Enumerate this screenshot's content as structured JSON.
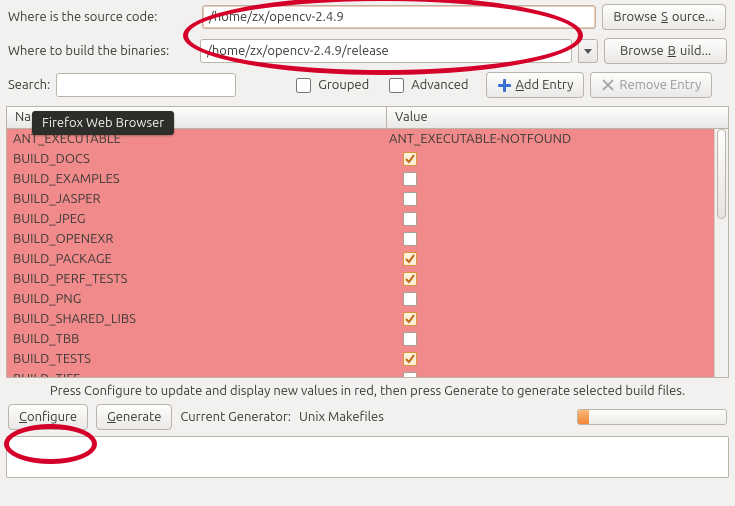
{
  "labels": {
    "source": "Where is the source code:",
    "build": "Where to build the binaries:",
    "search": "Search:",
    "grouped": "Grouped",
    "advanced": "Advanced",
    "name_header": "Name",
    "value_header": "Value",
    "help": "Press Configure to update and display new values in red, then press Generate to generate selected build files.",
    "current_generator_label": "Current Generator:"
  },
  "buttons": {
    "browse_source_pre": "Browse ",
    "browse_source_mn": "S",
    "browse_source_post": "ource...",
    "browse_build_pre": "Browse ",
    "browse_build_mn": "B",
    "browse_build_post": "uild...",
    "add_entry_mn": "A",
    "add_entry_post": "dd Entry",
    "remove_entry": "Remove Entry",
    "configure_mn": "C",
    "configure_post": "onfigure",
    "generate_mn": "G",
    "generate_post": "enerate"
  },
  "values": {
    "source_path": "/home/zx/opencv-2.4.9",
    "build_path": "/home/zx/opencv-2.4.9/release",
    "search": "",
    "grouped_checked": false,
    "advanced_checked": false,
    "generator": "Unix Makefiles"
  },
  "tooltip": "Firefox Web Browser",
  "variables": [
    {
      "name": "ANT_EXECUTABLE",
      "type": "string",
      "value": "ANT_EXECUTABLE-NOTFOUND"
    },
    {
      "name": "BUILD_DOCS",
      "type": "bool",
      "value": true
    },
    {
      "name": "BUILD_EXAMPLES",
      "type": "bool",
      "value": false
    },
    {
      "name": "BUILD_JASPER",
      "type": "bool",
      "value": false
    },
    {
      "name": "BUILD_JPEG",
      "type": "bool",
      "value": false
    },
    {
      "name": "BUILD_OPENEXR",
      "type": "bool",
      "value": false
    },
    {
      "name": "BUILD_PACKAGE",
      "type": "bool",
      "value": true
    },
    {
      "name": "BUILD_PERF_TESTS",
      "type": "bool",
      "value": true
    },
    {
      "name": "BUILD_PNG",
      "type": "bool",
      "value": false
    },
    {
      "name": "BUILD_SHARED_LIBS",
      "type": "bool",
      "value": true
    },
    {
      "name": "BUILD_TBB",
      "type": "bool",
      "value": false
    },
    {
      "name": "BUILD_TESTS",
      "type": "bool",
      "value": true
    },
    {
      "name": "BUILD_TIFF",
      "type": "bool",
      "value": false
    }
  ]
}
